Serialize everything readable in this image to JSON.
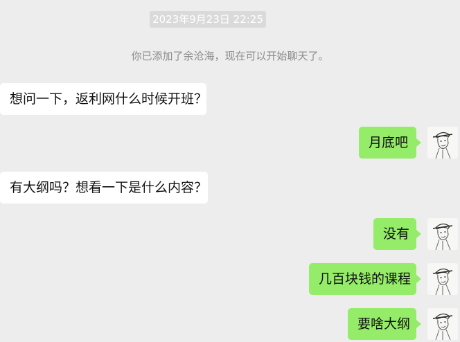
{
  "chat": {
    "timestamp": "2023年9月23日 22:25",
    "system_message": "你已添加了余沧海，现在可以开始聊天了。",
    "messages": [
      {
        "side": "left",
        "text": "想问一下，返利网什么时候开班？"
      },
      {
        "side": "right",
        "text": "月底吧",
        "avatar_icon": "sketch-portrait-avatar-icon"
      },
      {
        "side": "left",
        "text": "有大纲吗？想看一下是什么内容？"
      },
      {
        "side": "right",
        "text": "没有",
        "avatar_icon": "sketch-portrait-avatar-icon"
      },
      {
        "side": "right",
        "text": "几百块钱的课程",
        "avatar_icon": "sketch-portrait-avatar-icon"
      },
      {
        "side": "right",
        "text": "要啥大纲",
        "avatar_icon": "sketch-portrait-avatar-icon"
      }
    ]
  },
  "colors": {
    "background": "#ededed",
    "sent_bubble": "#95ec69",
    "received_bubble": "#ffffff",
    "timestamp_bg": "#dadada",
    "system_text": "#8c8c8c"
  }
}
